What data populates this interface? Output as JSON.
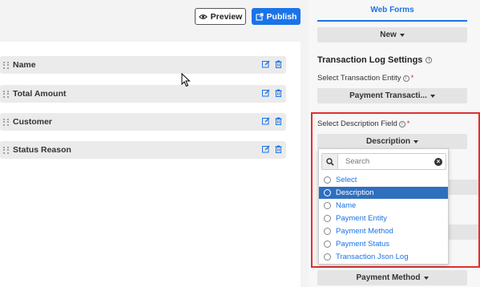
{
  "toolbar": {
    "preview_label": "Preview",
    "publish_label": "Publish"
  },
  "form_fields": [
    {
      "label": "Name"
    },
    {
      "label": "Total Amount"
    },
    {
      "label": "Customer"
    },
    {
      "label": "Status Reason"
    }
  ],
  "panel": {
    "tab_label": "Web Forms",
    "new_button": "New",
    "section_title": "Transaction Log Settings",
    "entity_label": "Select Transaction Entity",
    "entity_value": "Payment Transacti...",
    "desc_label": "Select Description Field",
    "desc_value": "Description",
    "bottom_value": "Payment Method",
    "required_mark": "*"
  },
  "dropdown": {
    "search_placeholder": "Search",
    "selected_index": 1,
    "options": [
      "Select",
      "Description",
      "Name",
      "Payment Entity",
      "Payment Method",
      "Payment Status",
      "Transaction Json Log"
    ]
  },
  "colors": {
    "accent": "#1a73e8",
    "highlight_border": "#e03030",
    "selected_option": "#2f6fbf"
  }
}
